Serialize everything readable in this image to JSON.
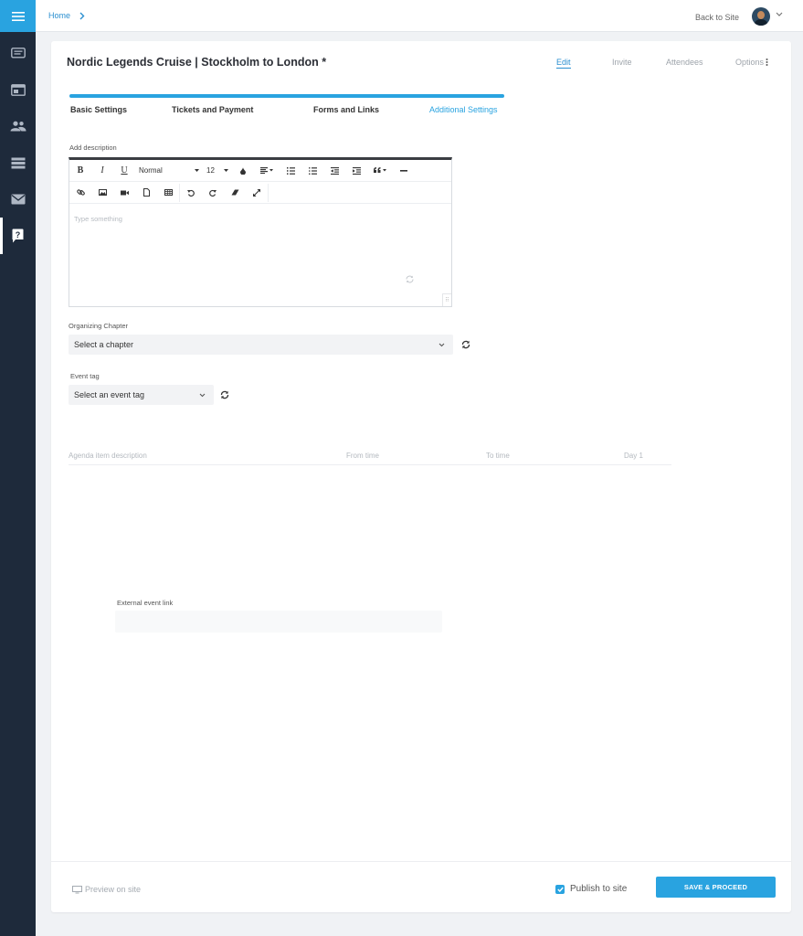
{
  "topbar": {
    "breadcrumb_home": "Home",
    "back_link": "Back to Site"
  },
  "event": {
    "title": "Nordic Legends Cruise | Stockholm to London *"
  },
  "top_links": {
    "edit": "Edit",
    "invite": "Invite",
    "attendees": "Attendees",
    "options": "Options"
  },
  "steps": [
    "Basic Settings",
    "Tickets and Payment",
    "Forms and Links",
    "Additional Settings"
  ],
  "progress": {
    "fraction": 1.0
  },
  "description": {
    "label": "Add description",
    "placeholder": "Type something",
    "toolbar": {
      "bold": "B",
      "italic": "I",
      "underline": "U",
      "style_value": "Normal",
      "size_value": "12",
      "resize_glyph": "⠿"
    }
  },
  "chapter": {
    "label": "Organizing Chapter",
    "value": "Select a chapter"
  },
  "event_tag": {
    "label": "Event tag",
    "value": "Select an event tag"
  },
  "agenda": {
    "columns": [
      "Agenda item description",
      "From time",
      "To time",
      "Day 1"
    ]
  },
  "external_link": {
    "label": "External event link",
    "value": ""
  },
  "footer": {
    "preview": "Preview on site",
    "publish": "Publish to site",
    "publish_checked": true,
    "save": "SAVE & PROCEED"
  },
  "colors": {
    "accent": "#29a3e0",
    "sidebar": "#1e2a3b"
  },
  "icons": {
    "sidebar": [
      "menu-icon",
      "messages-icon",
      "events-icon",
      "members-icon",
      "list-icon",
      "mail-icon",
      "help-icon"
    ]
  }
}
